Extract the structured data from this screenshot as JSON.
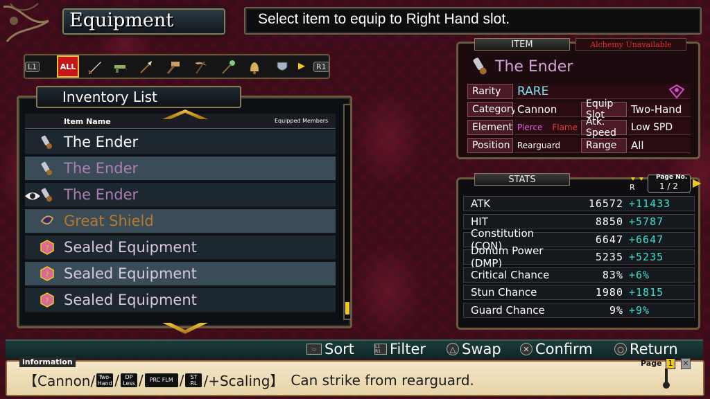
{
  "screen": {
    "title": "Equipment",
    "instruction": "Select item to equip to Right Hand slot."
  },
  "category_bar": {
    "left_button": "L1",
    "right_button": "R1",
    "all_label": "ALL",
    "icons": [
      "sword-icon",
      "gun-icon",
      "axe-icon",
      "spear-icon",
      "hammer-icon",
      "scythe-icon",
      "staff-icon",
      "bell-icon",
      "shield-icon"
    ],
    "selected": "ALL"
  },
  "inventory": {
    "header": "Inventory List",
    "col_item_name": "Item Name",
    "col_equipped": "Equipped Members",
    "items": [
      {
        "name": "The Ender",
        "icon": "cannon-icon",
        "color": "#ffffff"
      },
      {
        "name": "The Ender",
        "icon": "cannon-icon",
        "color": "#b07fb3"
      },
      {
        "name": "The Ender",
        "icon": "cannon-icon",
        "color": "#b07fb3"
      },
      {
        "name": "Great Shield",
        "icon": "shield-icon",
        "color": "#b57a2a"
      },
      {
        "name": "Sealed Equipment",
        "icon": "sealed-box-icon",
        "color": "#d8c8e0"
      },
      {
        "name": "Sealed Equipment",
        "icon": "sealed-box-icon",
        "color": "#d8c8e0"
      },
      {
        "name": "Sealed Equipment",
        "icon": "sealed-box-icon",
        "color": "#d8c8e0"
      }
    ],
    "cursor_row": 2
  },
  "item": {
    "tab": "ITEM",
    "alchemy": "Alchemy Unavailable",
    "name": "The Ender",
    "rarity_label": "Rarity",
    "rarity": "RARE",
    "category_label": "Category",
    "category": "Cannon",
    "equip_slot_label": "Equip Slot",
    "equip_slot": "Two-Hand",
    "element_label": "Element",
    "element_1": "Pierce",
    "element_2": "Flame",
    "atk_speed_label": "Atk. Speed",
    "atk_speed": "Low SPD",
    "position_label": "Position",
    "position": "Rearguard",
    "range_label": "Range",
    "range": "All"
  },
  "stats": {
    "tab": "STATS",
    "page_label": "Page No.",
    "page": "1 / 2",
    "rows": [
      {
        "label": "ATK",
        "base": "16572",
        "bonus": "+11433"
      },
      {
        "label": "HIT",
        "base": "8850",
        "bonus": "+5787"
      },
      {
        "label": "Constitution (CON)",
        "base": "6647",
        "bonus": "+6647"
      },
      {
        "label": "Donum Power (DMP)",
        "base": "5235",
        "bonus": "+5235"
      },
      {
        "label": "Critical Chance",
        "base": "83%",
        "bonus": "+6%"
      },
      {
        "label": "Stun Chance",
        "base": "1980",
        "bonus": "+1815"
      },
      {
        "label": "Guard Chance",
        "base": "9%",
        "bonus": "+9%"
      }
    ]
  },
  "controls": {
    "sort": "Sort",
    "filter": "Filter",
    "swap": "Swap",
    "confirm": "Confirm",
    "return": "Return"
  },
  "information": {
    "tab": "information",
    "open": "【Cannon/",
    "icon_two_hand": "Two-Hand",
    "slash1": "/",
    "icon_dp_less": "DP Less",
    "slash2": "/",
    "icon_prc_flm": "PRC FLM",
    "slash3": "/",
    "icon_st_rl": "ST RL",
    "close": "/+Scaling】",
    "description": "Can strike from rearguard.",
    "page_label": "Page",
    "page_num": "1"
  }
}
